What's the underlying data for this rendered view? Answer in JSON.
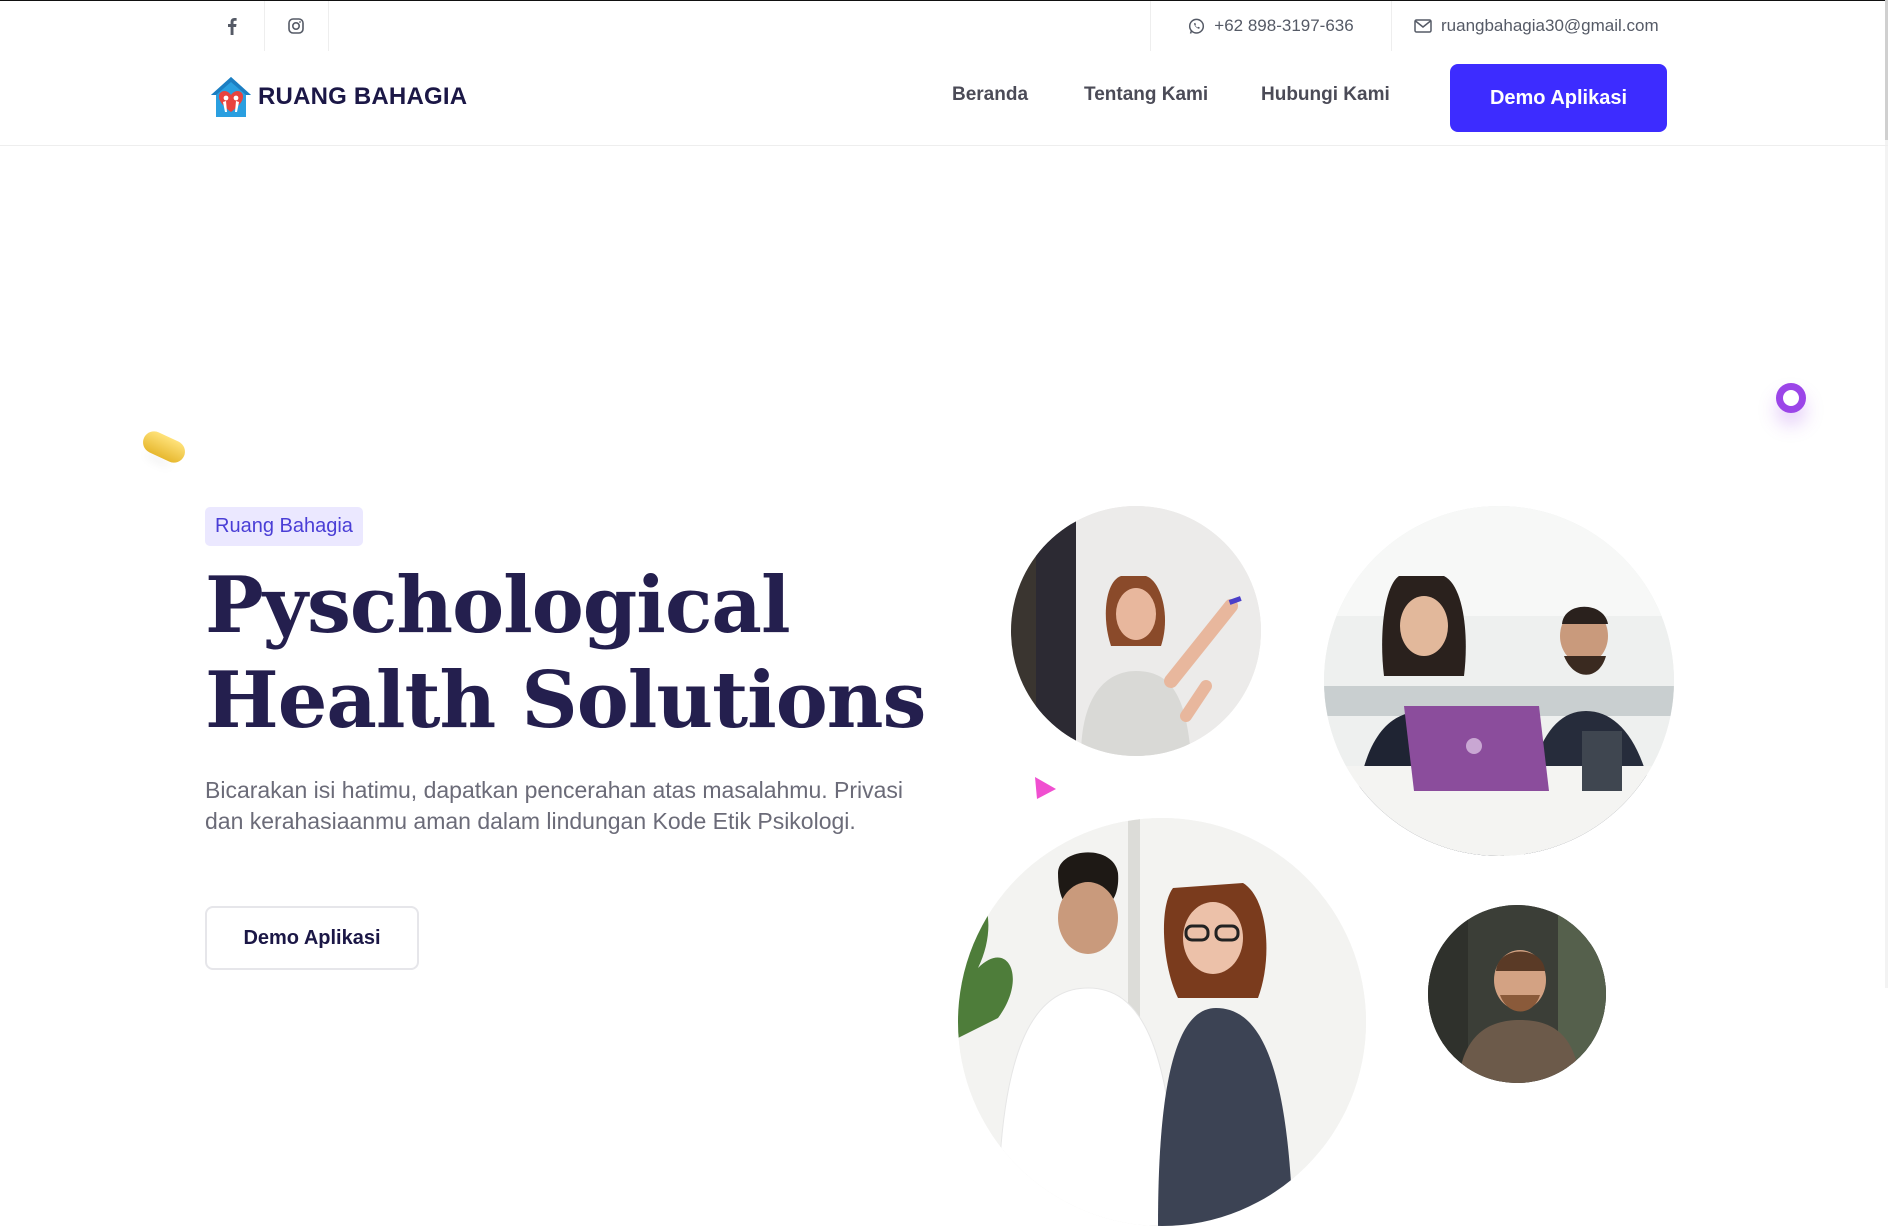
{
  "topbar": {
    "social": [
      "facebook-icon",
      "instagram-icon"
    ],
    "phone": "+62 898-3197-636",
    "email": "ruangbahagia30@gmail.com"
  },
  "navbar": {
    "logo_text": "RUANG BAHAGIA",
    "links": [
      "Beranda",
      "Tentang Kami",
      "Hubungi Kami"
    ],
    "cta": "Demo Aplikasi"
  },
  "hero": {
    "badge": "Ruang Bahagia",
    "title_line1": "Pyschological",
    "title_line2": "Health Solutions",
    "description": "Bicarakan isi hatimu, dapatkan pencerahan atas masalahmu. Privasi dan kerahasiaanmu aman dalam lindungan Kode Etik Psikologi.",
    "button": "Demo Aplikasi"
  },
  "colors": {
    "primary": "#3d2cff",
    "heading": "#241f4e",
    "badge_bg": "#ebe8ff"
  }
}
